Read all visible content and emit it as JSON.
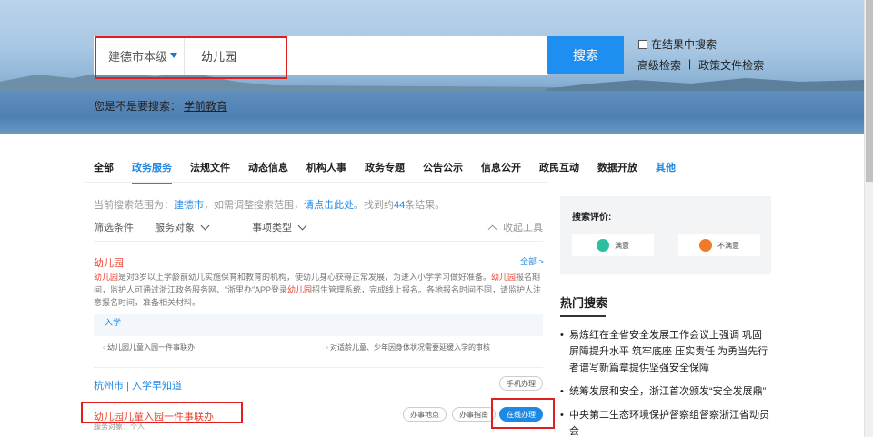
{
  "search": {
    "region": "建德市本级",
    "query": "幼儿园",
    "button": "搜索",
    "in_result_label": "在结果中搜索",
    "advanced": "高级检索",
    "policy": "政策文件检索",
    "suggest_prefix": "您是不是要搜索：",
    "suggest_keyword": "学前教育"
  },
  "tabs": [
    "全部",
    "政务服务",
    "法规文件",
    "动态信息",
    "机构人事",
    "政务专题",
    "公告公示",
    "信息公开",
    "政民互动",
    "数据开放",
    "其他"
  ],
  "scope": {
    "prefix": "当前搜索范围为：",
    "region": "建德市",
    "middle": "，如需调整搜索范围，",
    "link": "请点击此处",
    "suffix": "。找到约",
    "count": "44",
    "unit": "条结果。"
  },
  "filters": {
    "label": "筛选条件:",
    "service_object": "服务对象",
    "item_type": "事项类型",
    "collapse": "收起工具"
  },
  "result1": {
    "title": "幼儿园",
    "all_link": "全部 >",
    "desc_parts": [
      {
        "t": "幼儿园",
        "r": true
      },
      {
        "t": "是对3岁以上学龄前幼儿实施保育和教育的机构，使幼儿身心获得正常发展，为进入小学学习做好准备。",
        "r": false
      },
      {
        "t": "幼儿园",
        "r": true
      },
      {
        "t": "报名期间，监护人可通过浙江政务服务网、“浙里办”APP登录",
        "r": false
      },
      {
        "t": "幼儿园",
        "r": true
      },
      {
        "t": "招生管理系统，完成线上报名。各地报名时间不同，请监护人注意报名时间，准备相关材料。",
        "r": false
      }
    ],
    "sub_bar": "入学",
    "item_left": "◦ 幼儿园儿童入园一件事联办",
    "item_right": "◦ 对适龄儿童、少年因身体状况需要延缓入学的审核"
  },
  "result2": {
    "title": "杭州市 | 入学早知道",
    "mobile_btn": "手机办理",
    "item_title": "幼儿园儿童入园一件事联办",
    "item_sub": "服务对象：个人",
    "btn_location": "办事地点",
    "btn_guide": "办事指南",
    "btn_online": "在线办理"
  },
  "rating": {
    "title": "搜索评价:",
    "satisfied": "满意",
    "unsatisfied": "不满意"
  },
  "hot": {
    "title": "热门搜索",
    "items": [
      "易炼红在全省安全发展工作会议上强调 巩固屏障提升水平 筑牢底座 压实责任 为勇当先行者谱写新篇章提供坚强安全保障",
      "统筹发展和安全，浙江首次颁发“安全发展鼎”",
      "中央第二生态环境保护督察组督察浙江省动员会"
    ]
  },
  "colors": {
    "accent": "#1e88e5",
    "highlight": "#e8442f",
    "annotation": "#e02020"
  }
}
